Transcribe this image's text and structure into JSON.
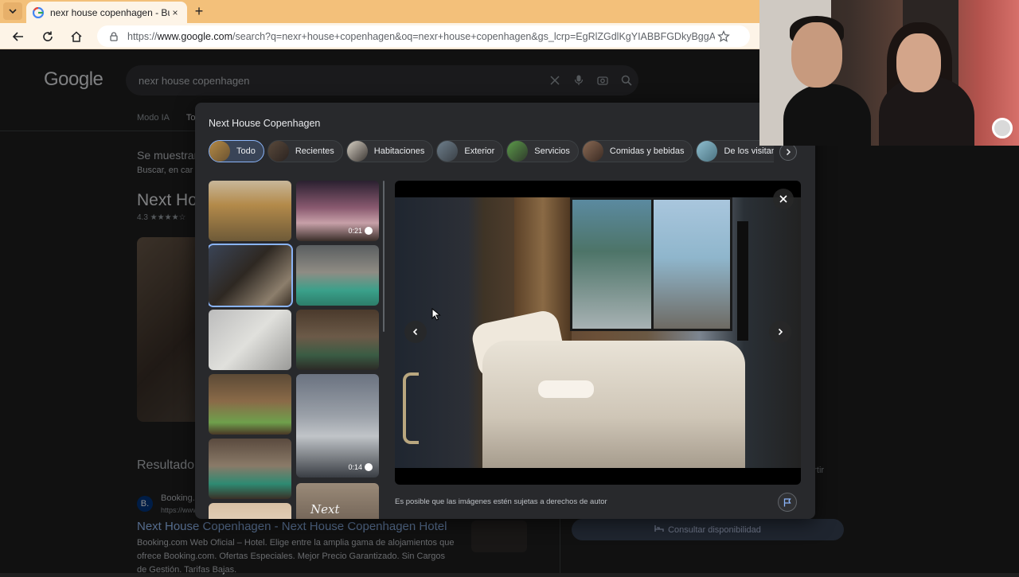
{
  "browser": {
    "tab_title": "nexr house copenhagen - Buscar",
    "tab_close": "×",
    "new_tab": "+",
    "url_prefix": "https://",
    "url_domain": "www.google.com",
    "url_rest": "/search?q=nexr+house+copenhagen&oq=nexr+house+copenhagen&gs_lcrp=EgRlZGdlKgYIABBFGDkyBggAEEUYOTI..."
  },
  "google": {
    "logo": "Google",
    "query": "nexr house copenhagen",
    "tabs": [
      "Modo IA",
      "Tod"
    ],
    "bg_text1": "Se muestran",
    "bg_text2": "Buscar, en car",
    "bg_title": "Next Ho",
    "bg_rating": "4.3 ★★★★☆",
    "results_label": "Resultado",
    "booking_badge": "B.",
    "booking_name": "Booking.c",
    "booking_url": "https://www",
    "result_link": "Next House Copenhagen - Next House Copenhagen Hotel",
    "result_desc": "Booking.com Web Oficial – Hotel. Elige entre la amplia gama de alojamientos que ofrece Booking.com. Ofertas Especiales. Mejor Precio Garantizado. Sin Cargos de Gestión. Tarifas Bajas.",
    "compartir": "partir",
    "consultar": "Consultar disponibilidad"
  },
  "modal": {
    "title": "Next House Copenhagen",
    "chips": [
      {
        "label": "Todo",
        "active": true
      },
      {
        "label": "Recientes",
        "active": false
      },
      {
        "label": "Habitaciones",
        "active": false
      },
      {
        "label": "Exterior",
        "active": false
      },
      {
        "label": "Servicios",
        "active": false
      },
      {
        "label": "Comidas y bebidas",
        "active": false
      },
      {
        "label": "De los visitantes",
        "active": false
      }
    ],
    "thumbnails": [
      {
        "duration": ""
      },
      {
        "duration": "0:21"
      },
      {
        "duration": ""
      },
      {
        "duration": ""
      },
      {
        "duration": ""
      },
      {
        "duration": ""
      },
      {
        "duration": ""
      },
      {
        "duration": "0:14"
      },
      {
        "duration": ""
      },
      {
        "duration": ""
      },
      {
        "duration": ""
      },
      {
        "brand": "Next House"
      }
    ],
    "copyright": "Es posible que las imágenes estén sujetas a derechos de autor"
  },
  "colors": {
    "accent": "#8ab4f8",
    "page_bg": "#1f1f1f",
    "modal_bg": "#28292c",
    "tabbar": "#f3c07a"
  }
}
